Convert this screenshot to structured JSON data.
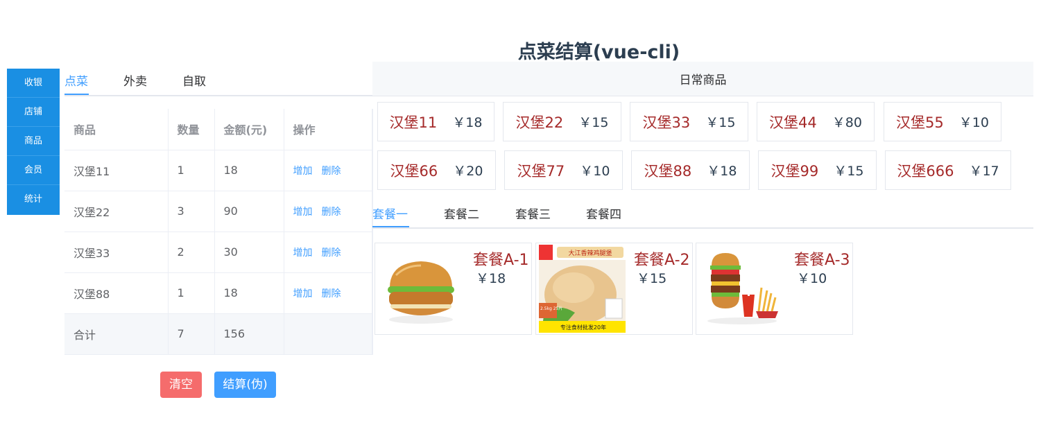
{
  "title": "点菜结算(vue-cli)",
  "side_menu": [
    "收银",
    "店铺",
    "商品",
    "会员",
    "统计"
  ],
  "order_tabs": [
    "点菜",
    "外卖",
    "自取"
  ],
  "table": {
    "headers": [
      "商品",
      "数量",
      "金额(元)",
      "操作"
    ],
    "rows": [
      {
        "name": "汉堡11",
        "qty": "1",
        "amount": "18"
      },
      {
        "name": "汉堡22",
        "qty": "3",
        "amount": "90"
      },
      {
        "name": "汉堡33",
        "qty": "2",
        "amount": "30"
      },
      {
        "name": "汉堡88",
        "qty": "1",
        "amount": "18"
      }
    ],
    "ops": {
      "add": "增加",
      "delete": "删除"
    },
    "total": {
      "label": "合计",
      "qty": "7",
      "amount": "156"
    }
  },
  "buttons": {
    "clear": "清空",
    "checkout": "结算(伪)"
  },
  "goods_header": "日常商品",
  "goods": [
    {
      "name": "汉堡11",
      "price": "￥18"
    },
    {
      "name": "汉堡22",
      "price": "￥15"
    },
    {
      "name": "汉堡33",
      "price": "￥15"
    },
    {
      "name": "汉堡44",
      "price": "￥80"
    },
    {
      "name": "汉堡55",
      "price": "￥10"
    },
    {
      "name": "汉堡66",
      "price": "￥20"
    },
    {
      "name": "汉堡77",
      "price": "￥10"
    },
    {
      "name": "汉堡88",
      "price": "￥18"
    },
    {
      "name": "汉堡99",
      "price": "￥15"
    },
    {
      "name": "汉堡666",
      "price": "￥17"
    }
  ],
  "combo_tabs": [
    "套餐一",
    "套餐二",
    "套餐三",
    "套餐四"
  ],
  "combos": [
    {
      "name": "套餐A-1",
      "price": "￥18",
      "image": "burger-image"
    },
    {
      "name": "套餐A-2",
      "price": "￥15",
      "image": "chicken-image"
    },
    {
      "name": "套餐A-3",
      "price": "￥10",
      "image": "burger-combo-image"
    }
  ],
  "combo_photo_text": {
    "banner": "大江香辣鸡腿堡",
    "footer": "专注食材批发20年",
    "badge": "2.5kg 25片"
  },
  "colors": {
    "menu": "#1a8fe3",
    "accent": "#409eff",
    "danger": "#f56c6c",
    "item_name": "#a52a2a"
  }
}
